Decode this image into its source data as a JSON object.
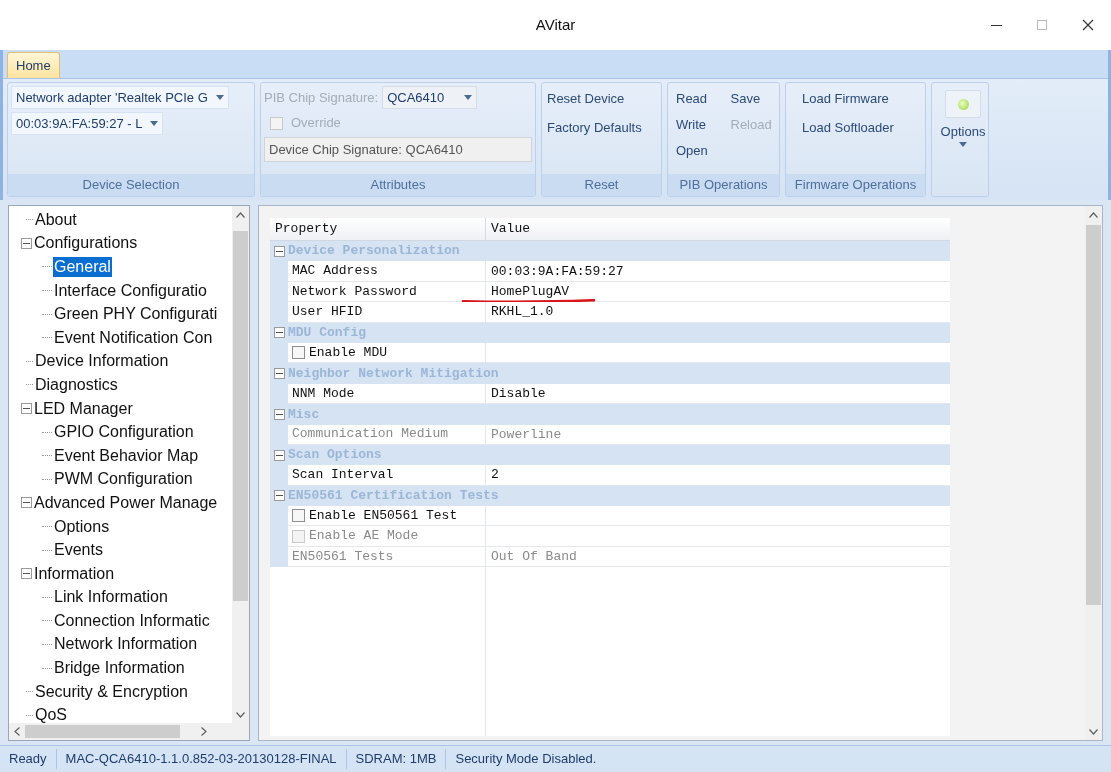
{
  "window": {
    "title": "AVitar"
  },
  "ribbon": {
    "tabs": [
      {
        "label": "Home",
        "selected": true
      }
    ],
    "groups": [
      {
        "label": "Device Selection",
        "items": [
          {
            "kind": "combo",
            "value": "Network adapter 'Realtek PCIe G"
          },
          {
            "kind": "combo",
            "value": "00:03:9A:FA:59:27 - L"
          }
        ]
      },
      {
        "label": "Attributes",
        "items": [
          {
            "kind": "labeled_combo",
            "label": "PIB Chip Signature:",
            "value": "QCA6410",
            "disabled": true
          },
          {
            "kind": "checkbox",
            "label": "Override",
            "checked": false,
            "disabled": true
          },
          {
            "kind": "readonly_field",
            "value": "Device Chip Signature: QCA6410"
          }
        ]
      },
      {
        "label": "Reset",
        "items": [
          {
            "kind": "button",
            "label": "Reset Device",
            "disabled": false
          },
          {
            "kind": "button",
            "label": "Factory Defaults",
            "disabled": false
          }
        ]
      },
      {
        "label": "PIB Operations",
        "items": [
          {
            "kind": "button",
            "label": "Read",
            "disabled": false
          },
          {
            "kind": "button",
            "label": "Save",
            "disabled": false
          },
          {
            "kind": "button",
            "label": "Write",
            "disabled": false
          },
          {
            "kind": "button",
            "label": "Reload",
            "disabled": true
          },
          {
            "kind": "button",
            "label": "Open",
            "disabled": false
          }
        ]
      },
      {
        "label": "Firmware Operations",
        "items": [
          {
            "kind": "button",
            "label": "Load Firmware",
            "disabled": false
          },
          {
            "kind": "button",
            "label": "Load Softloader",
            "disabled": false
          }
        ]
      },
      {
        "items": [
          {
            "kind": "big_button",
            "label": "Options"
          }
        ]
      }
    ]
  },
  "tree": {
    "items": [
      {
        "label": "About",
        "selected": false
      },
      {
        "label": "Configurations",
        "selected": false,
        "expanded": true,
        "children": [
          {
            "label": "General",
            "selected": true
          },
          {
            "label": "Interface Configuratio",
            "selected": false
          },
          {
            "label": "Green PHY Configurati",
            "selected": false
          },
          {
            "label": "Event Notification Con",
            "selected": false
          }
        ]
      },
      {
        "label": "Device Information",
        "selected": false
      },
      {
        "label": "Diagnostics",
        "selected": false
      },
      {
        "label": "LED Manager",
        "selected": false,
        "expanded": true,
        "children": [
          {
            "label": "GPIO Configuration",
            "selected": false
          },
          {
            "label": "Event Behavior Map",
            "selected": false
          },
          {
            "label": "PWM Configuration",
            "selected": false
          }
        ]
      },
      {
        "label": "Advanced Power Manage",
        "selected": false,
        "expanded": true,
        "children": [
          {
            "label": "Options",
            "selected": false
          },
          {
            "label": "Events",
            "selected": false
          }
        ]
      },
      {
        "label": "Information",
        "selected": false,
        "expanded": true,
        "children": [
          {
            "label": "Link Information",
            "selected": false
          },
          {
            "label": "Connection Informatic",
            "selected": false
          },
          {
            "label": "Network Information",
            "selected": false
          },
          {
            "label": "Bridge Information",
            "selected": false
          }
        ]
      },
      {
        "label": "Security & Encryption",
        "selected": false
      },
      {
        "label": "QoS",
        "selected": false
      }
    ]
  },
  "property_grid": {
    "columns": [
      "Property",
      "Value"
    ],
    "categories": [
      {
        "label": "Device Personalization",
        "expanded": true,
        "rows": [
          {
            "kind": "text",
            "property": "MAC Address",
            "value": "00:03:9A:FA:59:27",
            "disabled": false,
            "underlined": false
          },
          {
            "kind": "text",
            "property": "Network Password",
            "value": "HomePlugAV",
            "disabled": false,
            "underlined": true
          },
          {
            "kind": "text",
            "property": "User HFID",
            "value": "RKHL_1.0",
            "disabled": false,
            "underlined": false
          }
        ]
      },
      {
        "label": "MDU Config",
        "expanded": true,
        "rows": [
          {
            "kind": "checkbox",
            "property": "Enable MDU",
            "checked": false,
            "disabled": false
          }
        ]
      },
      {
        "label": "Neighbor Network Mitigation",
        "expanded": true,
        "rows": [
          {
            "kind": "text",
            "property": "NNM Mode",
            "value": "Disable",
            "disabled": false,
            "underlined": false
          }
        ]
      },
      {
        "label": "Misc",
        "expanded": true,
        "rows": [
          {
            "kind": "text",
            "property": "Communication Medium",
            "value": "Powerline",
            "disabled": true,
            "underlined": false
          }
        ]
      },
      {
        "label": "Scan Options",
        "expanded": true,
        "rows": [
          {
            "kind": "text",
            "property": "Scan Interval",
            "value": "2",
            "disabled": false,
            "underlined": false
          }
        ]
      },
      {
        "label": "EN50561 Certification Tests",
        "expanded": true,
        "rows": [
          {
            "kind": "checkbox",
            "property": "Enable EN50561 Test",
            "checked": false,
            "disabled": false
          },
          {
            "kind": "checkbox",
            "property": "Enable AE Mode",
            "checked": false,
            "disabled": true
          },
          {
            "kind": "text",
            "property": "EN50561 Tests",
            "value": "Out Of Band",
            "disabled": true,
            "underlined": false
          }
        ]
      }
    ]
  },
  "status_bar": [
    "Ready",
    "MAC-QCA6410-1.1.0.852-03-20130128-FINAL",
    "SDRAM: 1MB",
    "Security Mode Disabled."
  ]
}
